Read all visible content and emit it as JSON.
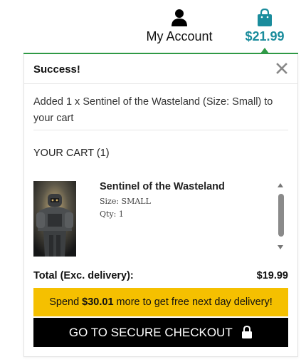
{
  "header": {
    "account_label": "My Account",
    "account_icon": "user-icon",
    "cart_total": "$21.99",
    "cart_icon": "shopping-bag-icon",
    "accent_color": "#1a8c9c"
  },
  "popup": {
    "success_title": "Success!",
    "close_icon": "close-icon",
    "added_message": "Added 1 x Sentinel of the Wasteland (Size: Small) to your cart",
    "cart_heading": "YOUR CART (1)",
    "items": [
      {
        "name": "Sentinel of the Wasteland",
        "size": "Size: SMALL",
        "qty": "Qty: 1"
      }
    ],
    "total_label": "Total (Exc. delivery):",
    "total_value": "$19.99",
    "promo_prefix": "Spend ",
    "promo_amount": "$30.01",
    "promo_suffix": " more to get free next day delivery!",
    "checkout_label": "GO TO SECURE CHECKOUT",
    "checkout_icon": "lock-icon",
    "colors": {
      "green_line": "#2f9a46",
      "promo_bg": "#f5c000",
      "checkout_bg": "#000000"
    }
  }
}
